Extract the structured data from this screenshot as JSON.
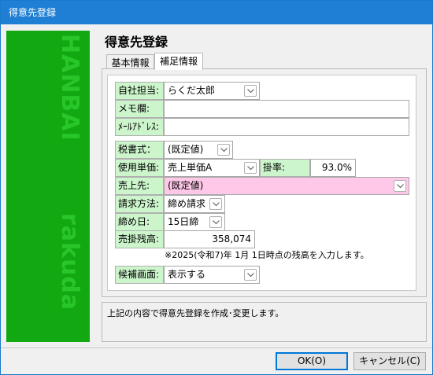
{
  "window": {
    "title": "得意先登録"
  },
  "side_panel": {
    "text_top": "HANBAI",
    "text_bottom": "rakuda"
  },
  "page": {
    "title": "得意先登録"
  },
  "tabs": [
    {
      "label": "基本情報"
    },
    {
      "label": "補足情報"
    }
  ],
  "form": {
    "staff": {
      "label": "自社担当:",
      "value": "らくだ太郎"
    },
    "memo": {
      "label": "メモ欄:",
      "value": ""
    },
    "email": {
      "label": "ﾒｰﾙｱﾄﾞﾚｽ:",
      "value": ""
    },
    "tax_format": {
      "label": "税書式：",
      "value": "(既定値)"
    },
    "unit_price": {
      "label": "使用単価:",
      "value": "売上単価A"
    },
    "rate": {
      "label": "掛率:",
      "value": "93.0%"
    },
    "sales_to": {
      "label": "売上先:",
      "value": "(既定値)"
    },
    "billing_method": {
      "label": "請求方法:",
      "value": "締め請求"
    },
    "closing_day": {
      "label": "締め日:",
      "value": "15日締"
    },
    "receivable": {
      "label": "売掛残高:",
      "value": "358,074"
    },
    "receivable_note": "※2025(令和7)年 1月 1日時点の残高を入力します。",
    "candidate_screen": {
      "label": "候補画面:",
      "value": "表示する"
    }
  },
  "message": "上記の内容で得意先登録を作成･変更します。",
  "buttons": {
    "ok": "OK(O)",
    "cancel": "キャンセル(C)"
  },
  "colors": {
    "titlebar": "#1f7fd4",
    "side_panel": "#12a812",
    "label_bg": "#ccf5cc",
    "sales_field_bg": "#ffc8e8"
  }
}
